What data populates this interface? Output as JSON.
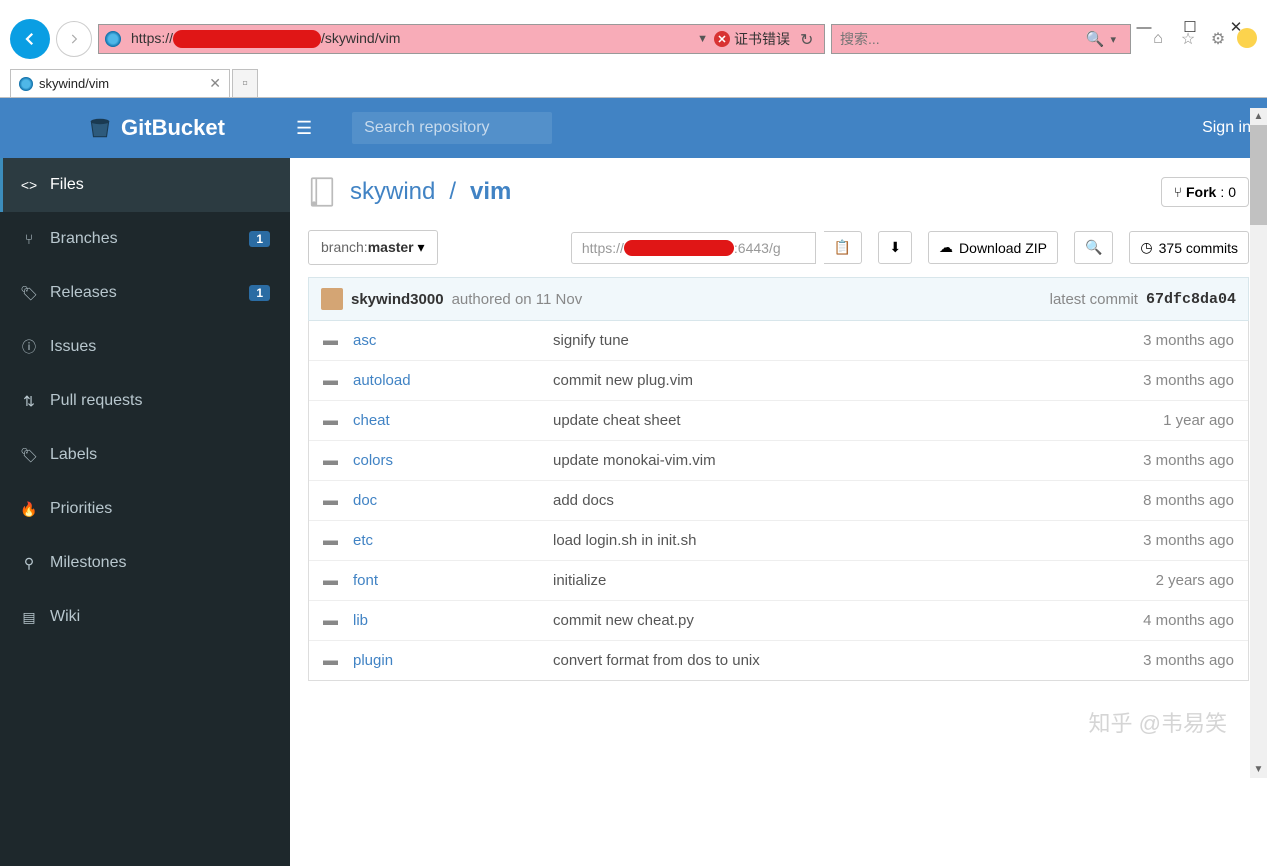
{
  "window": {
    "minimize": "—",
    "maximize": "☐",
    "close": "✕"
  },
  "browser": {
    "url_prefix": "https://",
    "url_suffix": "/skywind/vim",
    "cert_error": "证书错误",
    "search_placeholder": "搜索...",
    "tab_title": "skywind/vim"
  },
  "topbar": {
    "brand": "GitBucket",
    "search_placeholder": "Search repository",
    "signin": "Sign in"
  },
  "sidebar": [
    {
      "icon": "<>",
      "label": "Files",
      "badge": "",
      "active": true
    },
    {
      "icon": "⑂",
      "label": "Branches",
      "badge": "1"
    },
    {
      "icon": "🏷",
      "label": "Releases",
      "badge": "1"
    },
    {
      "icon": "ⓘ",
      "label": "Issues",
      "badge": ""
    },
    {
      "icon": "⇅",
      "label": "Pull requests",
      "badge": ""
    },
    {
      "icon": "🏷",
      "label": "Labels",
      "badge": ""
    },
    {
      "icon": "🔥",
      "label": "Priorities",
      "badge": ""
    },
    {
      "icon": "⚲",
      "label": "Milestones",
      "badge": ""
    },
    {
      "icon": "▤",
      "label": "Wiki",
      "badge": ""
    }
  ],
  "repo": {
    "owner": "skywind",
    "name": "vim",
    "fork_label": "Fork",
    "fork_count": "0",
    "branch_label": "branch:",
    "branch_name": "master",
    "clone_prefix": "https://",
    "clone_suffix": ":6443/g",
    "download": "Download ZIP",
    "commits": "375 commits"
  },
  "commit": {
    "author": "skywind3000",
    "action": "authored on 11 Nov",
    "latest_label": "latest commit",
    "sha": "67dfc8da04"
  },
  "files": [
    {
      "name": "asc",
      "msg": "signify tune",
      "age": "3 months ago"
    },
    {
      "name": "autoload",
      "msg": "commit new plug.vim",
      "age": "3 months ago"
    },
    {
      "name": "cheat",
      "msg": "update cheat sheet",
      "age": "1 year ago"
    },
    {
      "name": "colors",
      "msg": "update monokai-vim.vim",
      "age": "3 months ago"
    },
    {
      "name": "doc",
      "msg": "add docs",
      "age": "8 months ago"
    },
    {
      "name": "etc",
      "msg": "load login.sh in init.sh",
      "age": "3 months ago"
    },
    {
      "name": "font",
      "msg": "initialize",
      "age": "2 years ago"
    },
    {
      "name": "lib",
      "msg": "commit new cheat.py",
      "age": "4 months ago"
    },
    {
      "name": "plugin",
      "msg": "convert format from dos to unix",
      "age": "3 months ago"
    }
  ],
  "watermark": "知乎 @韦易笑"
}
